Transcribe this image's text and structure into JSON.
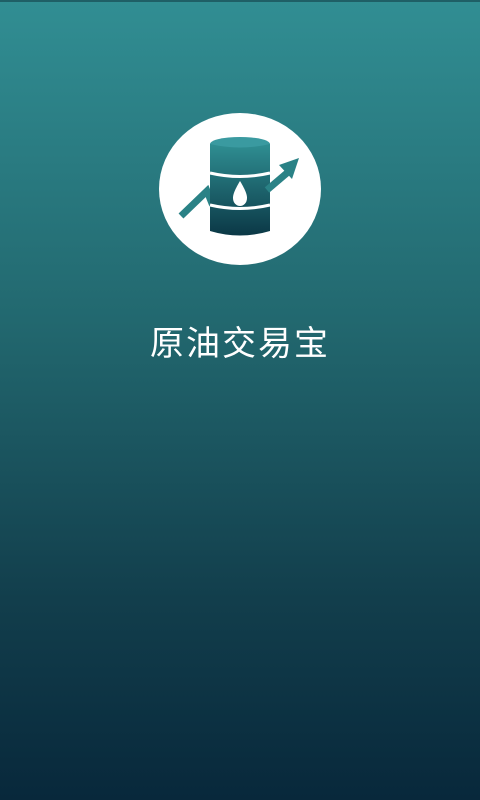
{
  "app": {
    "title": "原油交易宝",
    "logo_icon": "oil-barrel-rising-arrow-icon"
  },
  "colors": {
    "gradient_top": "#318e93",
    "gradient_bottom": "#08283b",
    "logo_background": "#ffffff",
    "barrel_light": "#2f8e92",
    "barrel_dark": "#0b3846",
    "title_text": "#ffffff"
  }
}
